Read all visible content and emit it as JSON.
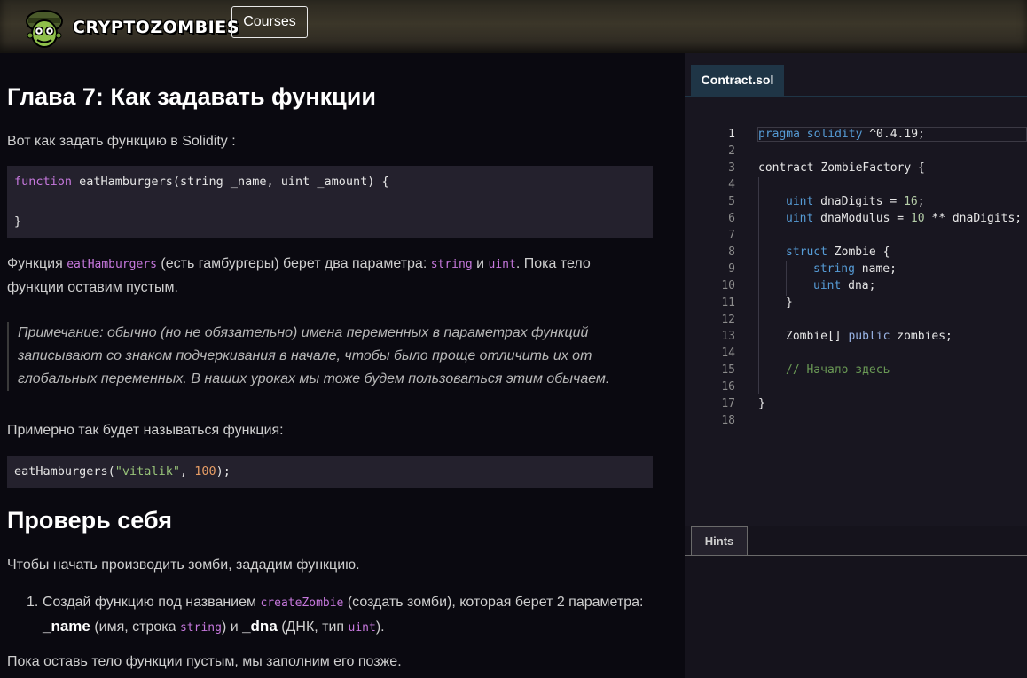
{
  "header": {
    "logo_text": "CRYPTOZOMBIES",
    "courses_label": "Courses"
  },
  "lesson": {
    "title": "Глава 7: Как задавать функции",
    "intro": "Вот как задать функцию в Solidity :",
    "code1": {
      "line1_kw": "function",
      "line1_rest": " eatHamburgers(string _name, uint _amount) {",
      "line3": "}"
    },
    "para2": {
      "t1": "Функция ",
      "c1": "eatHamburgers",
      "t2": " (есть гамбургеры) берет два параметра: ",
      "c2": "string",
      "t3": " и ",
      "c3": "uint",
      "t4": ". Пока тело функции оставим пустым."
    },
    "note": "Примечание: обычно (но не обязательно) имена переменных в параметрах функций записывают со знаком подчеркивания в начале, чтобы было проще отличить их от глобальных переменных. В наших уроках мы тоже будем пользоваться этим обычаем.",
    "para3": "Примерно так будет называться функция:",
    "code2": {
      "name": "eatHamburgers(",
      "str": "\"vitalik\"",
      "sep": ", ",
      "num": "100",
      "end": ");"
    },
    "section_title": "Проверь себя",
    "section_intro": "Чтобы начать производить зомби, зададим функцию.",
    "list_item": {
      "num": "1.",
      "t1": "Создай функцию под названием ",
      "c1": "createZombie",
      "t2": " (создать зомби), которая берет 2 параметра: ",
      "b1": "_name",
      "t3": " (имя, строка ",
      "c2": "string",
      "t4": ") и ",
      "b2": "_dna",
      "t5": " (ДНК, тип ",
      "c3": "uint",
      "t6": ")."
    },
    "outro": "Пока оставь тело функции пустым, мы заполним его позже."
  },
  "editor": {
    "tab_label": "Contract.sol",
    "line_numbers": [
      "1",
      "2",
      "3",
      "4",
      "5",
      "6",
      "7",
      "8",
      "9",
      "10",
      "11",
      "12",
      "13",
      "14",
      "15",
      "16",
      "17",
      "18"
    ],
    "code": {
      "l1_kw": "pragma solidity",
      "l1_rest": " ^0.4.19;",
      "l3": "contract ZombieFactory {",
      "l5_kw": "uint",
      "l5_rest": " dnaDigits = ",
      "l5_num": "16",
      "l5_end": ";",
      "l6_kw": "uint",
      "l6_rest": " dnaModulus = ",
      "l6_num": "10",
      "l6_end": " ** dnaDigits;",
      "l8_kw": "struct",
      "l8_rest": " Zombie {",
      "l9_kw": "string",
      "l9_rest": " name;",
      "l10_kw": "uint",
      "l10_rest": " dna;",
      "l11": "}",
      "l13_a": "Zombie[] ",
      "l13_kw": "public",
      "l13_b": " zombies;",
      "l15": "// Начало здесь",
      "l17": "}"
    },
    "hints_label": "Hints"
  },
  "colors": {
    "background": "#0a0910",
    "code_bg": "#24212d",
    "editor_bg": "#181620",
    "tab_bg": "#1f3546",
    "keyword": "#c678dd",
    "string": "#98c379",
    "number": "#e59c65"
  }
}
